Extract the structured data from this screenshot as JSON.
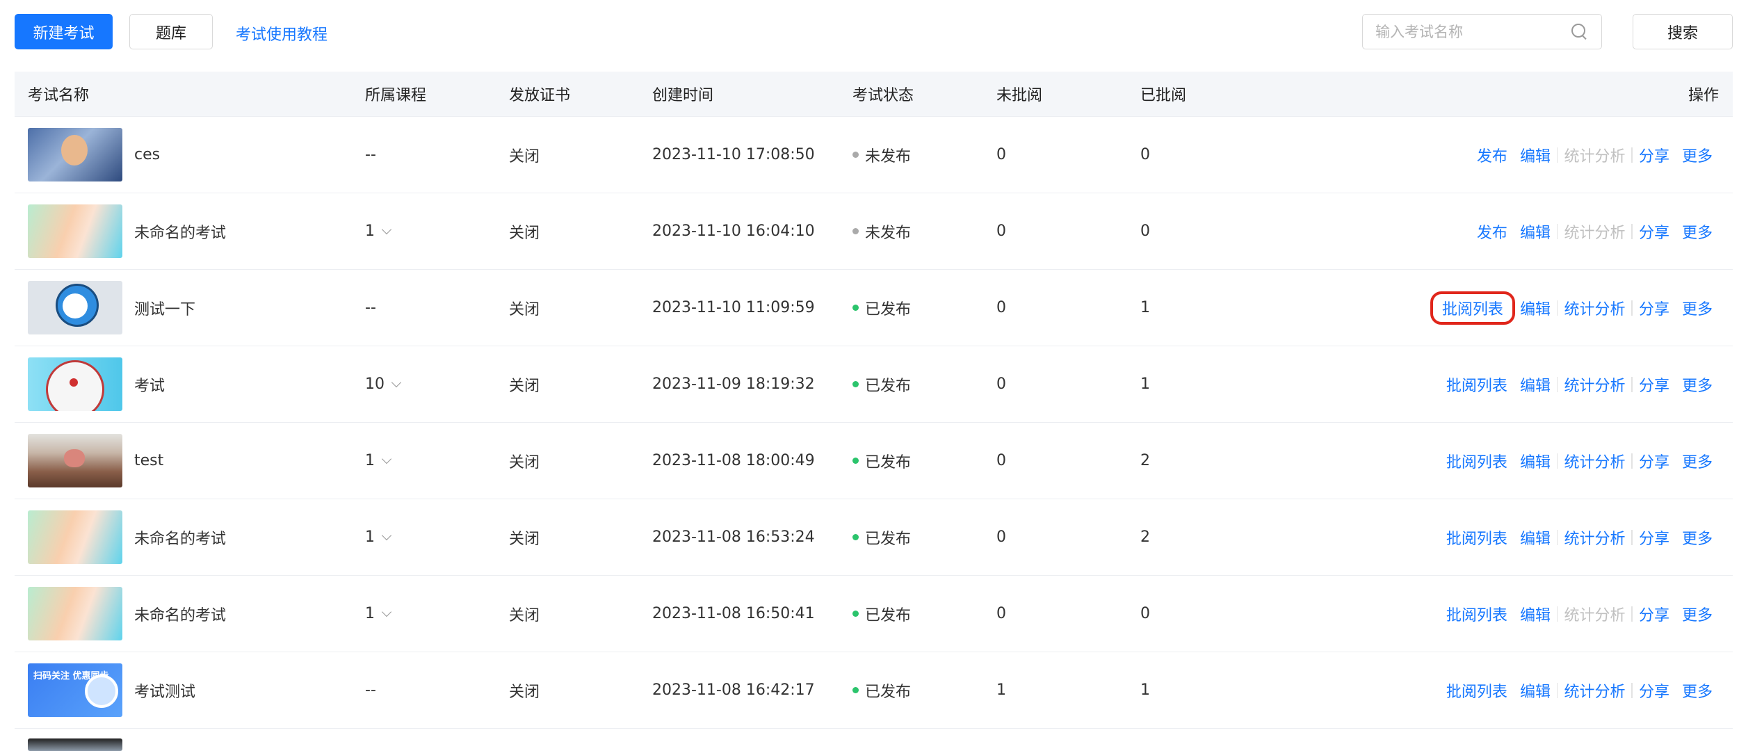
{
  "toolbar": {
    "new_exam_label": "新建考试",
    "question_bank_label": "题库",
    "tutorial_link": "考试使用教程",
    "search_placeholder": "输入考试名称",
    "search_button_label": "搜索"
  },
  "table": {
    "headers": {
      "name": "考试名称",
      "course": "所属课程",
      "certificate": "发放证书",
      "created": "创建时间",
      "status": "考试状态",
      "unreviewed": "未批阅",
      "reviewed": "已批阅",
      "actions": "操作"
    },
    "rows": [
      {
        "thumb": "photo",
        "name": "ces",
        "course": "--",
        "course_has_dropdown": false,
        "certificate": "关闭",
        "created": "2023-11-10 17:08:50",
        "status": "未发布",
        "status_color": "#aaaaaa",
        "unreviewed": "0",
        "reviewed": "0",
        "actions": [
          {
            "label": "发布",
            "disabled": false
          },
          {
            "label": "编辑",
            "disabled": false
          },
          {
            "label": "统计分析",
            "disabled": true
          },
          {
            "label": "分享",
            "disabled": false
          },
          {
            "label": "更多",
            "disabled": false
          }
        ]
      },
      {
        "thumb": "gradient",
        "name": "未命名的考试",
        "course": "1",
        "course_has_dropdown": true,
        "certificate": "关闭",
        "created": "2023-11-10 16:04:10",
        "status": "未发布",
        "status_color": "#aaaaaa",
        "unreviewed": "0",
        "reviewed": "0",
        "actions": [
          {
            "label": "发布",
            "disabled": false
          },
          {
            "label": "编辑",
            "disabled": false
          },
          {
            "label": "统计分析",
            "disabled": true
          },
          {
            "label": "分享",
            "disabled": false
          },
          {
            "label": "更多",
            "disabled": false
          }
        ]
      },
      {
        "thumb": "doraemon",
        "name": "测试一下",
        "course": "--",
        "course_has_dropdown": false,
        "certificate": "关闭",
        "created": "2023-11-10 11:09:59",
        "status": "已发布",
        "status_color": "#2bc46c",
        "unreviewed": "0",
        "reviewed": "1",
        "actions": [
          {
            "label": "批阅列表",
            "disabled": false,
            "highlighted": true
          },
          {
            "label": "编辑",
            "disabled": false
          },
          {
            "label": "统计分析",
            "disabled": false
          },
          {
            "label": "分享",
            "disabled": false
          },
          {
            "label": "更多",
            "disabled": false
          }
        ]
      },
      {
        "thumb": "doraemon2",
        "name": "考试",
        "course": "10",
        "course_has_dropdown": true,
        "certificate": "关闭",
        "created": "2023-11-09 18:19:32",
        "status": "已发布",
        "status_color": "#2bc46c",
        "unreviewed": "0",
        "reviewed": "1",
        "actions": [
          {
            "label": "批阅列表",
            "disabled": false
          },
          {
            "label": "编辑",
            "disabled": false
          },
          {
            "label": "统计分析",
            "disabled": false
          },
          {
            "label": "分享",
            "disabled": false
          },
          {
            "label": "更多",
            "disabled": false
          }
        ]
      },
      {
        "thumb": "desert",
        "name": "test",
        "course": "1",
        "course_has_dropdown": true,
        "certificate": "关闭",
        "created": "2023-11-08 18:00:49",
        "status": "已发布",
        "status_color": "#2bc46c",
        "unreviewed": "0",
        "reviewed": "2",
        "actions": [
          {
            "label": "批阅列表",
            "disabled": false
          },
          {
            "label": "编辑",
            "disabled": false
          },
          {
            "label": "统计分析",
            "disabled": false
          },
          {
            "label": "分享",
            "disabled": false
          },
          {
            "label": "更多",
            "disabled": false
          }
        ]
      },
      {
        "thumb": "gradient",
        "name": "未命名的考试",
        "course": "1",
        "course_has_dropdown": true,
        "certificate": "关闭",
        "created": "2023-11-08 16:53:24",
        "status": "已发布",
        "status_color": "#2bc46c",
        "unreviewed": "0",
        "reviewed": "2",
        "actions": [
          {
            "label": "批阅列表",
            "disabled": false
          },
          {
            "label": "编辑",
            "disabled": false
          },
          {
            "label": "统计分析",
            "disabled": false
          },
          {
            "label": "分享",
            "disabled": false
          },
          {
            "label": "更多",
            "disabled": false
          }
        ]
      },
      {
        "thumb": "gradient",
        "name": "未命名的考试",
        "course": "1",
        "course_has_dropdown": true,
        "certificate": "关闭",
        "created": "2023-11-08 16:50:41",
        "status": "已发布",
        "status_color": "#2bc46c",
        "unreviewed": "0",
        "reviewed": "0",
        "actions": [
          {
            "label": "批阅列表",
            "disabled": false
          },
          {
            "label": "编辑",
            "disabled": false
          },
          {
            "label": "统计分析",
            "disabled": true
          },
          {
            "label": "分享",
            "disabled": false
          },
          {
            "label": "更多",
            "disabled": false
          }
        ]
      },
      {
        "thumb": "promo",
        "thumb_text": "扫码关注 优惠同步",
        "name": "考试测试",
        "course": "--",
        "course_has_dropdown": false,
        "certificate": "关闭",
        "created": "2023-11-08 16:42:17",
        "status": "已发布",
        "status_color": "#2bc46c",
        "unreviewed": "1",
        "reviewed": "1",
        "actions": [
          {
            "label": "批阅列表",
            "disabled": false
          },
          {
            "label": "编辑",
            "disabled": false
          },
          {
            "label": "统计分析",
            "disabled": false
          },
          {
            "label": "分享",
            "disabled": false
          },
          {
            "label": "更多",
            "disabled": false
          }
        ]
      }
    ]
  },
  "colors": {
    "primary": "#1677ff",
    "published": "#2bc46c",
    "unpublished": "#aaaaaa",
    "disabled_action": "#c0c0c0",
    "highlight": "#e0261b"
  }
}
